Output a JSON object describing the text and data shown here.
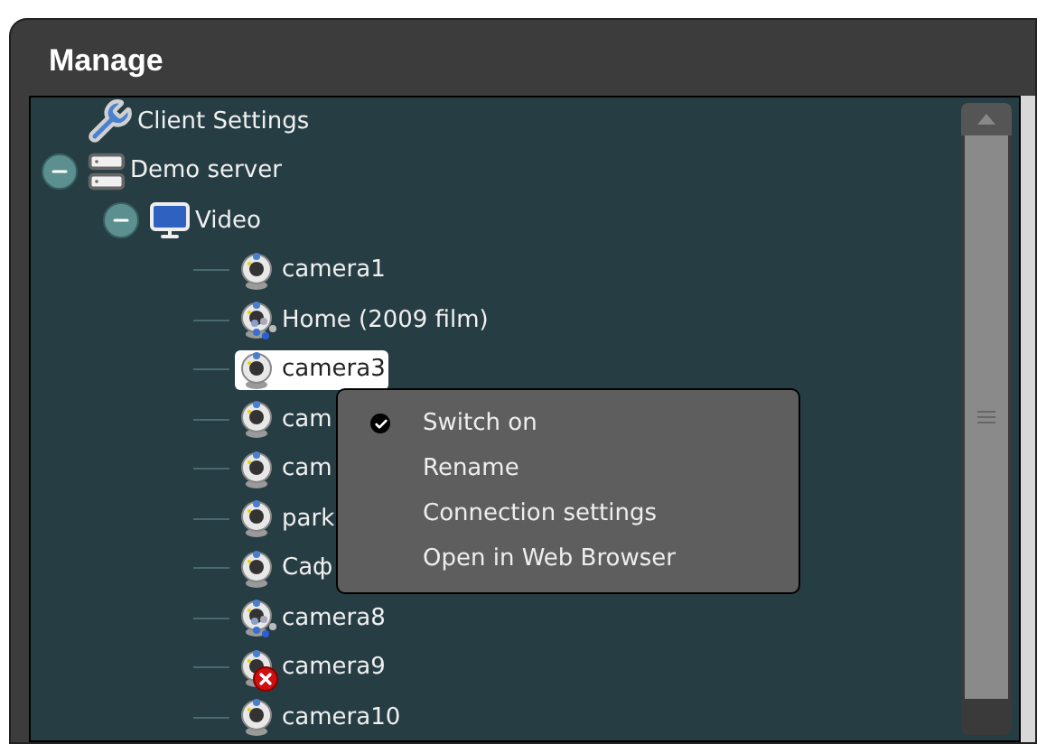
{
  "window": {
    "title": "Manage"
  },
  "tree": [
    {
      "label": "Client Settings",
      "kind": "settings"
    },
    {
      "label": "Demo server",
      "kind": "server",
      "expanded": true,
      "children": [
        {
          "label": "Video",
          "kind": "video",
          "expanded": true,
          "children": [
            {
              "label": "camera1",
              "kind": "camera",
              "busy": false,
              "error": false,
              "selected": false
            },
            {
              "label": "Home (2009 film)",
              "kind": "camera",
              "busy": true,
              "error": false,
              "selected": false
            },
            {
              "label": "camera3",
              "kind": "camera",
              "busy": false,
              "error": false,
              "selected": true
            },
            {
              "label": "cam",
              "kind": "camera",
              "busy": false,
              "error": false,
              "selected": false
            },
            {
              "label": "cam",
              "kind": "camera",
              "busy": false,
              "error": false,
              "selected": false
            },
            {
              "label": "park",
              "kind": "camera",
              "busy": false,
              "error": false,
              "selected": false
            },
            {
              "label": "Саф",
              "kind": "camera",
              "busy": false,
              "error": false,
              "selected": false
            },
            {
              "label": "camera8",
              "kind": "camera",
              "busy": true,
              "error": false,
              "selected": false
            },
            {
              "label": "camera9",
              "kind": "camera",
              "busy": false,
              "error": true,
              "selected": false
            },
            {
              "label": "camera10",
              "kind": "camera",
              "busy": false,
              "error": false,
              "selected": false
            }
          ]
        }
      ]
    }
  ],
  "context_menu": [
    {
      "label": "Switch on",
      "checked": true
    },
    {
      "label": "Rename",
      "checked": false
    },
    {
      "label": "Connection settings",
      "checked": false
    },
    {
      "label": "Open in Web Browser",
      "checked": false
    }
  ]
}
